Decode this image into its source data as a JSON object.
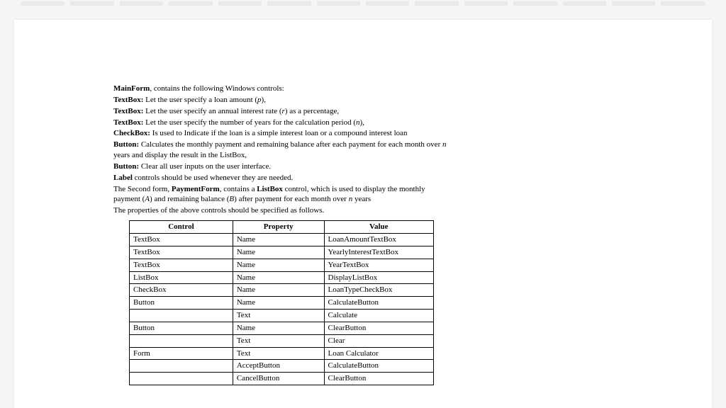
{
  "intro": {
    "line1_a": "MainForm",
    "line1_b": ", contains the following Windows controls:",
    "tb1_a": "TextBox:",
    "tb1_b": " Let the user specify a loan amount (",
    "tb1_c": "p",
    "tb1_d": "),",
    "tb2_a": "TextBox:",
    "tb2_b": " Let the user specify an annual interest rate (",
    "tb2_c": "r",
    "tb2_d": ") as a percentage,",
    "tb3_a": "TextBox:",
    "tb3_b": " Let the user specify the number of years for the calculation period (",
    "tb3_c": "n",
    "tb3_d": "),",
    "cb_a": "CheckBox:",
    "cb_b": " Is used to Indicate if the loan is a simple interest loan or a compound interest loan",
    "btn1_a": "Button:",
    "btn1_b": " Calculates the monthly payment and remaining balance after each payment for each month over ",
    "btn1_c": "n",
    "btn1_d": " years and display the result in the ListBox,",
    "btn2_a": "Button:",
    "btn2_b": " Clear all user inputs on the user interface.",
    "lbl_a": "Label",
    "lbl_b": " controls should be used whenever they are needed."
  },
  "second": {
    "a": "The Second form, ",
    "b": "PaymentForm",
    "c": ", contains a ",
    "d": "ListBox",
    "e": " control, which is used to display the monthly payment (",
    "f": "A",
    "g": ") and remaining balance (",
    "h": "B",
    "i": ") after payment for each month over ",
    "j": "n",
    "k": " years"
  },
  "tableIntro": "The properties of the above controls should be specified as follows.",
  "table": {
    "headers": [
      "Control",
      "Property",
      "Value"
    ],
    "rows": [
      [
        "TextBox",
        "Name",
        "LoanAmountTextBox"
      ],
      [
        "TextBox",
        "Name",
        "YearlyInterestTextBox"
      ],
      [
        "TextBox",
        "Name",
        "YearTextBox"
      ],
      [
        "ListBox",
        "Name",
        "DisplayListBox"
      ],
      [
        "CheckBox",
        "Name",
        "LoanTypeCheckBox"
      ],
      [
        "Button",
        "Name",
        "CalculateButton"
      ],
      [
        "",
        "Text",
        "Calculate"
      ],
      [
        "Button",
        "Name",
        "ClearButton"
      ],
      [
        "",
        "Text",
        "Clear"
      ],
      [
        "Form",
        "Text",
        "Loan Calculator"
      ],
      [
        "",
        "AcceptButton",
        "CalculateButton"
      ],
      [
        "",
        "CancelButton",
        "ClearButton"
      ]
    ]
  }
}
